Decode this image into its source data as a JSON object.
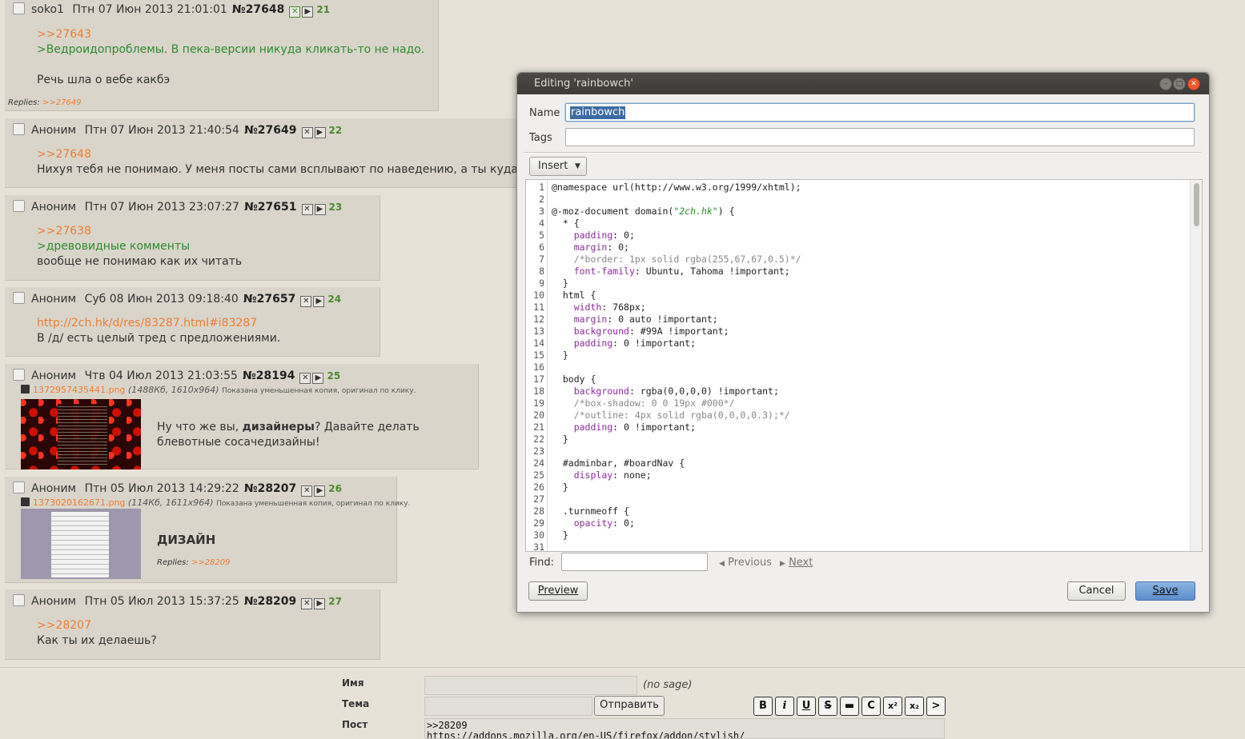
{
  "posts": [
    {
      "name": "soko1",
      "date": "Птн 07 Июн 2013 21:01:01",
      "num": "№27648",
      "count": "21",
      "lines": [
        ">>27643",
        ">Ведроидопроблемы. В пека-версии никуда кликать-то не надо.",
        "",
        "Речь шла о вебе какбэ"
      ],
      "replies_label": "Replies:",
      "replies_link": ">>27649"
    },
    {
      "name": "Аноним",
      "date": "Птн 07 Июн 2013 21:40:54",
      "num": "№27649",
      "count": "22",
      "lines": [
        ">>27648",
        "Нихуя тебя не понимаю. У меня посты сами всплывают по наведению, а ты куда-то"
      ]
    },
    {
      "name": "Аноним",
      "date": "Птн 07 Июн 2013 23:07:27",
      "num": "№27651",
      "count": "23",
      "lines": [
        ">>27638",
        ">древовидные комменты",
        "вообще не понимаю как их читать"
      ]
    },
    {
      "name": "Аноним",
      "date": "Суб 08 Июн 2013 09:18:40",
      "num": "№27657",
      "count": "24",
      "lines": [
        "http://2ch.hk/d/res/83287.html#i83287",
        "В /д/ есть целый тред с предложениями."
      ]
    },
    {
      "name": "Аноним",
      "date": "Чтв 04 Июл 2013 21:03:55",
      "num": "№28194",
      "count": "25",
      "file_name": "1372957435441.png",
      "file_meta": "(1488Кб, 1610x964)",
      "file_note": "Показана уменьшенная копия, оригинал по клику.",
      "text_a": "Ну что же вы, ",
      "text_bold": "дизайнеры",
      "text_b": "? Давайте делать",
      "text_c": "блевотные сосачедизайны!"
    },
    {
      "name": "Аноним",
      "date": "Птн 05 Июл 2013 14:29:22",
      "num": "№28207",
      "count": "26",
      "file_name": "1373020162671.png",
      "file_meta": "(114Кб, 1611x964)",
      "file_note": "Показана уменьшенная копия, оригинал по клику.",
      "text_bold": "ДИЗАЙН",
      "replies_label": "Replies:",
      "replies_link": ">>28209"
    },
    {
      "name": "Аноним",
      "date": "Птн 05 Июл 2013 15:37:25",
      "num": "№28209",
      "count": "27",
      "lines": [
        ">>28207",
        "Как ты их делаешь?"
      ]
    }
  ],
  "form": {
    "name_label": "Имя",
    "nosage": "(no sage)",
    "subject_label": "Тема",
    "submit": "Отправить",
    "post_label": "Пост",
    "post_text_1": ">>28209",
    "post_text_2": "https://addons.mozilla.org/en-US/firefox/addon/stylish/",
    "format_buttons": [
      "B",
      "i",
      "U",
      "S",
      "▬",
      "C",
      "x²",
      "x₂",
      ">"
    ]
  },
  "dialog": {
    "title": "Editing 'rainbowch'",
    "name_label": "Name",
    "name_value": "rainbowch",
    "tags_label": "Tags",
    "insert_label": "Insert",
    "find_label": "Find:",
    "previous_label": "Previous",
    "next_label": "Next",
    "preview_label": "Preview",
    "cancel_label": "Cancel",
    "save_label": "Save",
    "code": [
      "@namespace url(http://www.w3.org/1999/xhtml);",
      "",
      "@-moz-document domain(\"2ch.hk\") {",
      "  * {",
      "    padding: 0;",
      "    margin: 0;",
      "    /*border: 1px solid rgba(255,67,67,0.5)*/",
      "    font-family: Ubuntu, Tahoma !important;",
      "  }",
      "  html {",
      "    width: 768px;",
      "    margin: 0 auto !important;",
      "    background: #99A !important;",
      "    padding: 0 !important;",
      "  }",
      "",
      "  body {",
      "    background: rgba(0,0,0,0) !important;",
      "    /*box-shadow: 0 0 19px #000*/",
      "    /*outline: 4px solid rgba(0,0,0,0.3);*/",
      "    padding: 0 !important;",
      "  }",
      "",
      "  #adminbar, #boardNav {",
      "    display: none;",
      "  }",
      "",
      "  .turnmeoff {",
      "    opacity: 0;",
      "  }",
      ""
    ]
  },
  "colors": {
    "accent": "#ee7d32",
    "quote": "#2e8b2e",
    "save": "#5d8dcb"
  }
}
